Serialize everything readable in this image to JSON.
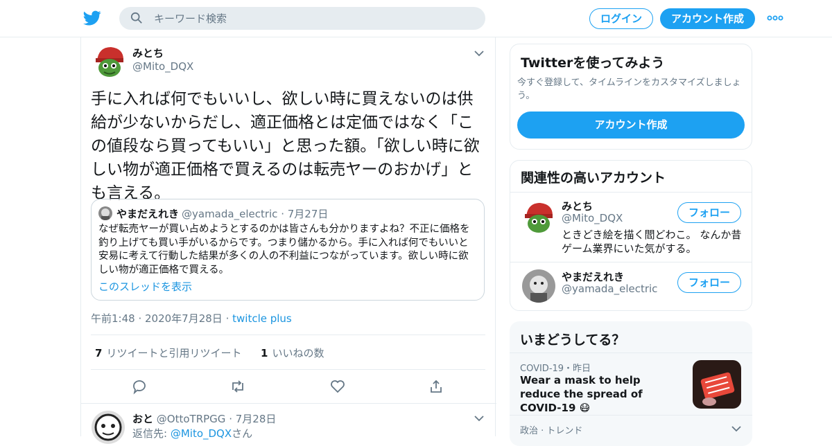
{
  "topbar": {
    "search_placeholder": "キーワード検索",
    "login_label": "ログイン",
    "signup_label": "アカウント作成",
    "brand_color": "#1da1f2"
  },
  "tweet": {
    "name": "みとち",
    "handle": "@Mito_DQX",
    "text": "手に入れば何でもいいし、欲しい時に買えないのは供給が少ないからだし、適正価格とは定価ではなく「この値段なら買ってもいい」と思った額。「欲しい時に欲しい物が適正価格で買えるのは転売ヤーのおかげ」とも言える。",
    "quote": {
      "name": "やまだえれき",
      "handle": "@yamada_electric",
      "date": "7月27日",
      "text": "なぜ転売ヤーが買い占めようとするのかは皆さんも分かりますよね？不正に価格を釣り上げても買い手がいるからです。つまり儲かるから。手に入れば何でもいいと安易に考えて行動した結果が多くの人の不利益につながっています。欲しい時に欲しい物が適正価格で買える。",
      "link": "このスレッドを表示"
    },
    "time": "午前1:48",
    "date": "2020年7月28日",
    "source": "twitcle plus",
    "retweets": "7",
    "retweets_label": "リツイートと引用リツイート",
    "likes": "1",
    "likes_label": "いいねの数"
  },
  "reply": {
    "name": "おと",
    "handle": "@OttoTRPGG",
    "date": "7月28日",
    "to_prefix": "返信先: ",
    "to_handle": "@Mito_DQX",
    "to_suffix": "さん"
  },
  "sidebar": {
    "signup_card": {
      "title": "Twitterを使ってみよう",
      "subtitle": "今すぐ登録して、タイムラインをカスタマイズしましょう。",
      "button": "アカウント作成"
    },
    "related": {
      "title": "関連性の高いアカウント",
      "accounts": [
        {
          "name": "みとち",
          "handle": "@Mito_DQX",
          "bio": "ときどき絵を描く閻どわこ。 なんか昔ゲーム業界にいた気がする。",
          "follow": "フォロー"
        },
        {
          "name": "やまだえれき",
          "handle": "@yamada_electric",
          "bio": "",
          "follow": "フォロー"
        }
      ]
    },
    "trends": {
      "title": "いまどうしてる？",
      "item1_meta": "COVID-19・昨日",
      "item1_title": "Wear a mask to help reduce the spread of COVID-19 😷",
      "item2_meta": "政治 · トレンド"
    }
  }
}
